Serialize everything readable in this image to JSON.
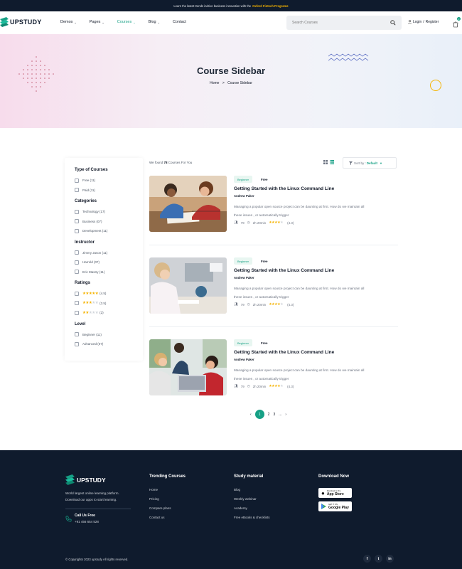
{
  "announcement": {
    "text": "Learn the latest trends indrive business innovation with the",
    "highlight": "Oxford Fintech Programe"
  },
  "header": {
    "logo": "UPSTUDY",
    "nav": [
      {
        "label": "Demos"
      },
      {
        "label": "Pages"
      },
      {
        "label": "Courses"
      },
      {
        "label": "Blog"
      },
      {
        "label": "Contact"
      }
    ],
    "search_placeholder": "Search Courses",
    "login": "Login",
    "divider": "/",
    "register": "Register",
    "cart_count": "0"
  },
  "hero": {
    "title": "Course Sidebar",
    "breadcrumb_home": "Home",
    "breadcrumb_sep": ">",
    "breadcrumb_current": "Course Sidebar"
  },
  "sidebar": {
    "type_heading": "Type of Courses",
    "type_items": [
      "Free (11)",
      "Paid (11)"
    ],
    "categories_heading": "Categories",
    "categories_items": [
      "Technology (17)",
      "Business (07)",
      "Development (11)"
    ],
    "instructor_heading": "Instructor",
    "instructor_items": [
      "Jimmy Jason (11)",
      "Harrold (07)",
      "Eric Maxtry (11)"
    ],
    "ratings_heading": "Ratings",
    "ratings": [
      {
        "stars": 5,
        "label": "(4.5)"
      },
      {
        "stars": 3,
        "label": "(3.5)"
      },
      {
        "stars": 2,
        "label": "(2)"
      }
    ],
    "level_heading": "Level",
    "level_items": [
      "Beginner (11)",
      "Advanced (07)"
    ]
  },
  "toolbar": {
    "found_prefix": "We found",
    "found_count": "78",
    "found_suffix": "Courses For You",
    "sort_label": "Sort by :",
    "sort_value": "Default"
  },
  "courses": [
    {
      "level": "Beginner",
      "price": "Free",
      "title": "Getting Started with the Linux Command Line",
      "author": "Andrew Paker",
      "desc_line1": "Managing a popular open source project can be daunting at first. How do we maintain all",
      "desc_line2": "these issues , or automatically trigger",
      "students": "79",
      "duration": "2h 20min",
      "rating": "(4.3)"
    },
    {
      "level": "Beginner",
      "price": "Free",
      "title": "Getting Started with the Linux Command Line",
      "author": "Andrew Paker",
      "desc_line1": "Managing a popular open source project can be daunting at first. How do we maintain all",
      "desc_line2": "these issues , or automatically trigger",
      "students": "79",
      "duration": "2h 20min",
      "rating": "(4.3)"
    },
    {
      "level": "Beginner",
      "price": "Free",
      "title": "Getting Started with the Linux Command Line",
      "author": "Andrew Paker",
      "desc_line1": "Managing a popular open source project can be daunting at first. How do we maintain all",
      "desc_line2": "these issues , or automatically trigger",
      "students": "79",
      "duration": "2h 20min",
      "rating": "(4.3)"
    }
  ],
  "pagination": {
    "prev": "‹",
    "pages": [
      "1",
      "2",
      "3"
    ],
    "ellipsis": "...",
    "next": "›",
    "current": "1"
  },
  "footer": {
    "logo": "UPSTUDY",
    "tagline_line1": "World largest online learning platform.",
    "tagline_line2": "Download our apps to start learning.",
    "call_label": "Call Us Free",
    "call_number": "+91 456 654 528",
    "col1_heading": "Trending Courses",
    "col1_links": [
      "Home",
      "Pricing",
      "Compare plans",
      "Contact us"
    ],
    "col2_heading": "Study material",
    "col2_links": [
      "Blog",
      "Weekly webinar",
      "Academy",
      "Free eBooks & checklists"
    ],
    "col3_heading": "Download Now",
    "appstore_small": "Download on the",
    "appstore_big": "App Store",
    "gplay_small": "GET IT ON",
    "gplay_big": "Google Play",
    "copyright": "© Copyrights 2023 upstudy All rights reserved.",
    "socials": [
      "f",
      "t",
      "in"
    ]
  },
  "colors": {
    "accent": "#16a085",
    "star": "#f5b301",
    "footer_bg": "#0f1b2d"
  }
}
